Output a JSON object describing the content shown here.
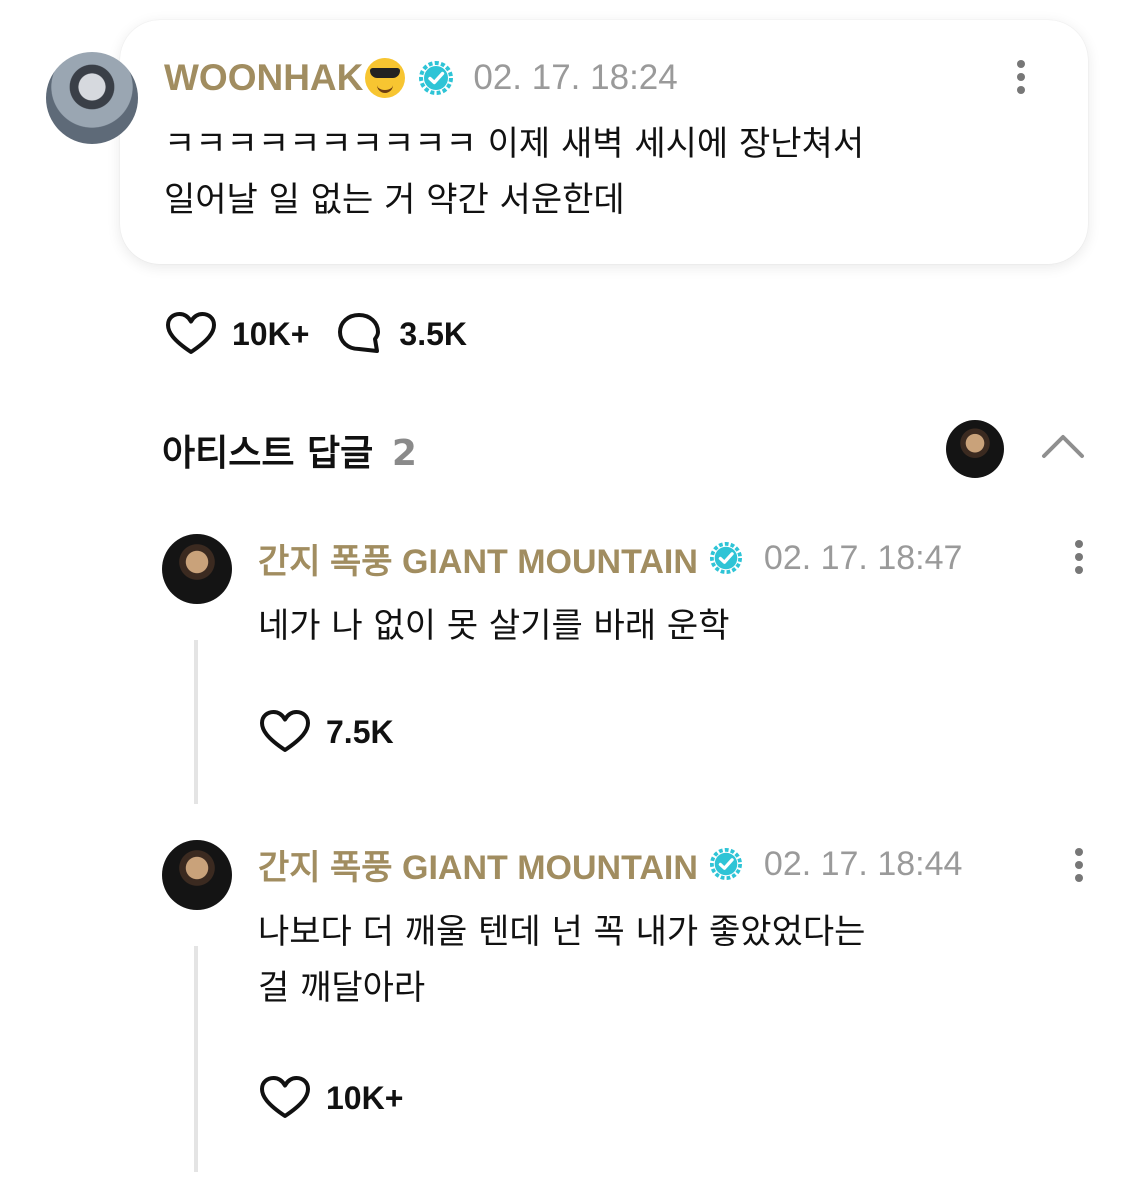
{
  "post": {
    "author": "WOONHAK",
    "author_emoji": "sunglasses-emoji",
    "timestamp": "02. 17. 18:24",
    "body_line1": "ㅋㅋㅋㅋㅋㅋㅋㅋㅋㅋ 이제 새벽 세시에 장난쳐서",
    "body_line2": "일어날 일 없는 거 약간 서운한데",
    "likes": "10K+",
    "comments": "3.5K"
  },
  "artist_replies": {
    "title": "아티스트 답글",
    "count": "2",
    "collapse_icon": "chevron-up-icon"
  },
  "replies": [
    {
      "author": "간지 폭풍 GIANT MOUNTAIN",
      "timestamp": "02. 17. 18:47",
      "body_line1": "네가 나 없이 못 살기를 바래 운학",
      "body_line2": "",
      "likes": "7.5K"
    },
    {
      "author": "간지 폭풍 GIANT MOUNTAIN",
      "timestamp": "02. 17. 18:44",
      "body_line1": "나보다 더 깨울 텐데 넌 꼭 내가 좋았었다는",
      "body_line2": "걸 깨달아라",
      "likes": "10K+"
    }
  ],
  "colors": {
    "author_name": "#a18d60",
    "verified_badge": "#2ec4d6",
    "timestamp": "#9a9a9a",
    "thread_line": "#e4e4e4"
  }
}
